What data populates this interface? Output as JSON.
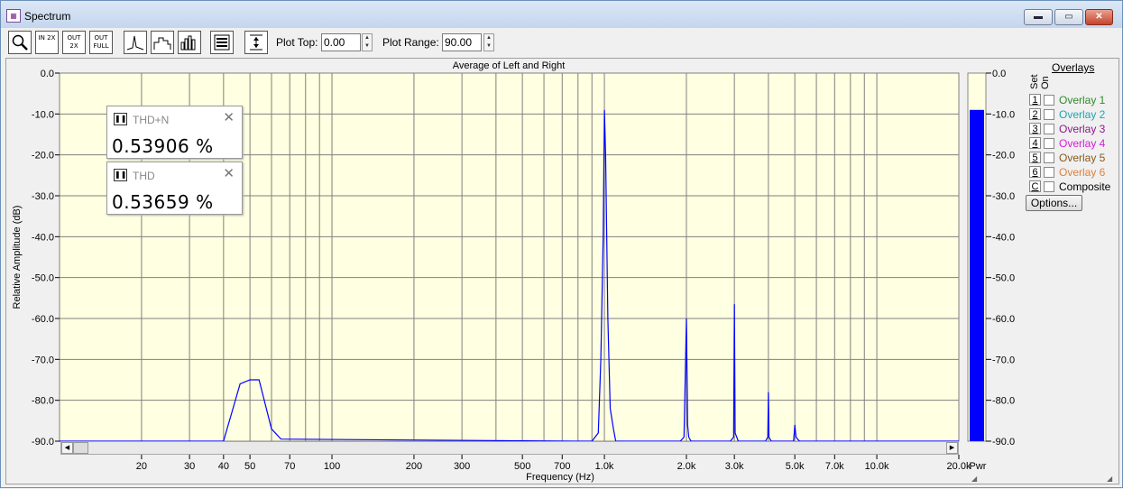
{
  "window": {
    "title": "Spectrum",
    "icon": "spectrum-app-icon"
  },
  "window_controls": {
    "minimize": "▬",
    "maximize": "▭",
    "close": "✕"
  },
  "toolbar": {
    "zoom_in_label": "IN 2X",
    "zoom_out_label": "OUT 2X",
    "zoom_full_label": "OUT FULL",
    "plot_top_label": "Plot Top:",
    "plot_top_value": "0.00",
    "plot_range_label": "Plot Range:",
    "plot_range_value": "90.00"
  },
  "readouts": [
    {
      "label": "THD+N",
      "value": "0.53906 %"
    },
    {
      "label": "THD",
      "value": "0.53659 %"
    }
  ],
  "meter": {
    "label": "Pwr",
    "level_db": -9
  },
  "overlays": {
    "title": "Overlays",
    "set_label": "Set On",
    "items": [
      {
        "num": "1",
        "name": "Overlay 1",
        "color": "#2e8b2e"
      },
      {
        "num": "2",
        "name": "Overlay 2",
        "color": "#1aa6b0"
      },
      {
        "num": "3",
        "name": "Overlay 3",
        "color": "#8a1a8a"
      },
      {
        "num": "4",
        "name": "Overlay 4",
        "color": "#d91ad9"
      },
      {
        "num": "5",
        "name": "Overlay 5",
        "color": "#8a5a1a"
      },
      {
        "num": "6",
        "name": "Overlay 6",
        "color": "#e0803a"
      },
      {
        "num": "C",
        "name": "Composite",
        "color": "#000000"
      }
    ],
    "options_button": "Options..."
  },
  "colors": {
    "plot_bg": "#ffffe1",
    "trace": "#0000ff",
    "meter_fill": "#0000ff"
  },
  "chart_data": {
    "type": "line",
    "title": "Average of Left and Right",
    "xlabel": "Frequency (Hz)",
    "ylabel": "Relative Amplitude (dB)",
    "xscale": "log",
    "xlim": [
      10,
      20000
    ],
    "ylim": [
      -90,
      0
    ],
    "yticks": [
      0,
      -10,
      -20,
      -30,
      -40,
      -50,
      -60,
      -70,
      -80,
      -90
    ],
    "ytick_labels": [
      "0.0",
      "-10.0",
      "-20.0",
      "-30.0",
      "-40.0",
      "-50.0",
      "-60.0",
      "-70.0",
      "-80.0",
      "-90.0"
    ],
    "xticks": [
      20,
      30,
      40,
      50,
      70,
      100,
      200,
      300,
      500,
      700,
      1000,
      2000,
      3000,
      5000,
      7000,
      10000,
      20000
    ],
    "xtick_labels": [
      "20",
      "30",
      "40",
      "50",
      "70",
      "100",
      "200",
      "300",
      "500",
      "700",
      "1.0k",
      "2.0k",
      "3.0k",
      "5.0k",
      "7.0k",
      "10.0k",
      "20.0k"
    ],
    "grid": true,
    "series": [
      {
        "x": [
          10,
          40,
          46,
          50,
          54,
          60,
          65,
          800,
          900,
          950,
          970,
          990,
          1000,
          1010,
          1030,
          1050,
          1080,
          1100,
          1900,
          1960,
          2000,
          2020,
          2040,
          2080,
          2900,
          2980,
          3000,
          3020,
          3100,
          3900,
          3980,
          4000,
          4020,
          4100,
          4950,
          5000,
          5050,
          5200,
          20000
        ],
        "y": [
          -90,
          -90,
          -76,
          -75,
          -75,
          -87,
          -89.5,
          -90,
          -90,
          -88,
          -70,
          -40,
          -9,
          -20,
          -60,
          -82,
          -87,
          -90,
          -90,
          -89,
          -60,
          -86,
          -89,
          -90,
          -90,
          -89,
          -56.5,
          -88,
          -90,
          -90,
          -89,
          -78,
          -89,
          -90,
          -90,
          -86,
          -89,
          -90,
          -90
        ]
      }
    ]
  }
}
